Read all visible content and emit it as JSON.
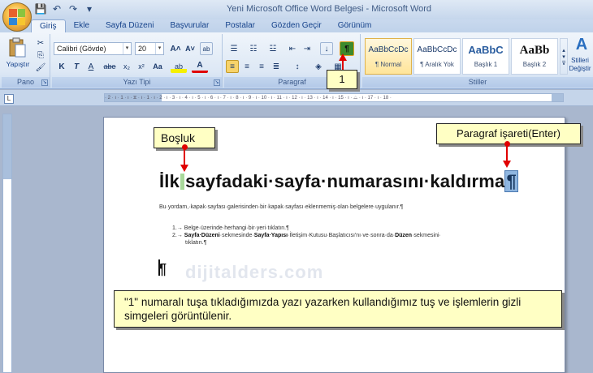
{
  "window": {
    "title": "Yeni Microsoft Office Word Belgesi - Microsoft Word",
    "quick_access": [
      "💾",
      "↶",
      "↷",
      "▾"
    ]
  },
  "tabs": [
    "Giriş",
    "Ekle",
    "Sayfa Düzeni",
    "Başvurular",
    "Postalar",
    "Gözden Geçir",
    "Görünüm"
  ],
  "active_tab": "Giriş",
  "ribbon": {
    "clipboard": {
      "paste_label": "Yapıştır",
      "group_label": "Pano"
    },
    "font": {
      "font_name": "Calibri (Gövde)",
      "font_size": "20",
      "grow": "A˄",
      "shrink": "A˅",
      "clear": "ab",
      "bold": "K",
      "italic": "T",
      "underline": "A",
      "strike": "abe",
      "subscript": "x₂",
      "superscript": "x²",
      "change_case": "Aa",
      "highlight": "ab",
      "font_color": "A",
      "group_label": "Yazı Tipi"
    },
    "paragraph": {
      "sort": "↓",
      "show_marks": "¶",
      "group_label": "Paragraf"
    },
    "styles": {
      "items": [
        {
          "sample": "AaBbCcDc",
          "name": "¶ Normal"
        },
        {
          "sample": "AaBbCcDc",
          "name": "¶ Aralık Yok"
        },
        {
          "sample": "AaBbC",
          "name": "Başlık 1"
        },
        {
          "sample": "AaBb",
          "name": "Başlık 2"
        }
      ],
      "change_styles": "Stilleri Değiştir",
      "group_label": "Stiller"
    }
  },
  "ruler": {
    "ticks": "· 2 · ı · 1 · ı · ⧖ · ı · 1 · ı · 2 · ı · 3 · ı · 4 · ı · 5 · ı · 6 · ı · 7 · ı · 8 · ı · 9 · ı · 10 · ı · 11 · ı · 12 · ı · 13 · ı · 14 · ı · 15 · ı · △ · ı · 17 · ı · 18 ·",
    "corner": "L"
  },
  "document": {
    "heading_pre": "İlk",
    "heading_post": "sayfadaki·sayfa·numarasını·kaldırma",
    "heading_mark": "¶",
    "body": "Bu·yordam,·kapak·sayfası·galerisinden·bir·kapak·sayfası·eklenmemiş·olan·belgelere·uygulanır.¶",
    "list": [
      {
        "num": "1.→",
        "text": "Belge·üzerinde·herhangi·bir·yeri·tıklatın.¶"
      },
      {
        "num": "2.→",
        "pre": "",
        "bold1": "Sayfa·Düzeni",
        "mid1": "·sekmesinde·",
        "bold2": "Sayfa·Yapısı",
        "mid2": "·İletişim·Kutusu·Başlatıcısı'nı·ve·sonra·da·",
        "bold3": "Düzen",
        "post": "·sekmesini·",
        "cont": "tıklatın.¶"
      }
    ],
    "empty_mark": "¶",
    "watermark": "dijitalders.com"
  },
  "callouts": {
    "bosluk": "Boşluk",
    "paragraf": "Paragraf işareti(Enter)",
    "one": "1",
    "info": "\"1\" numaralı tuşa tıkladığımızda yazı yazarken kullandığımız tuş ve işlemlerin gizli simgeleri görüntülenir."
  }
}
